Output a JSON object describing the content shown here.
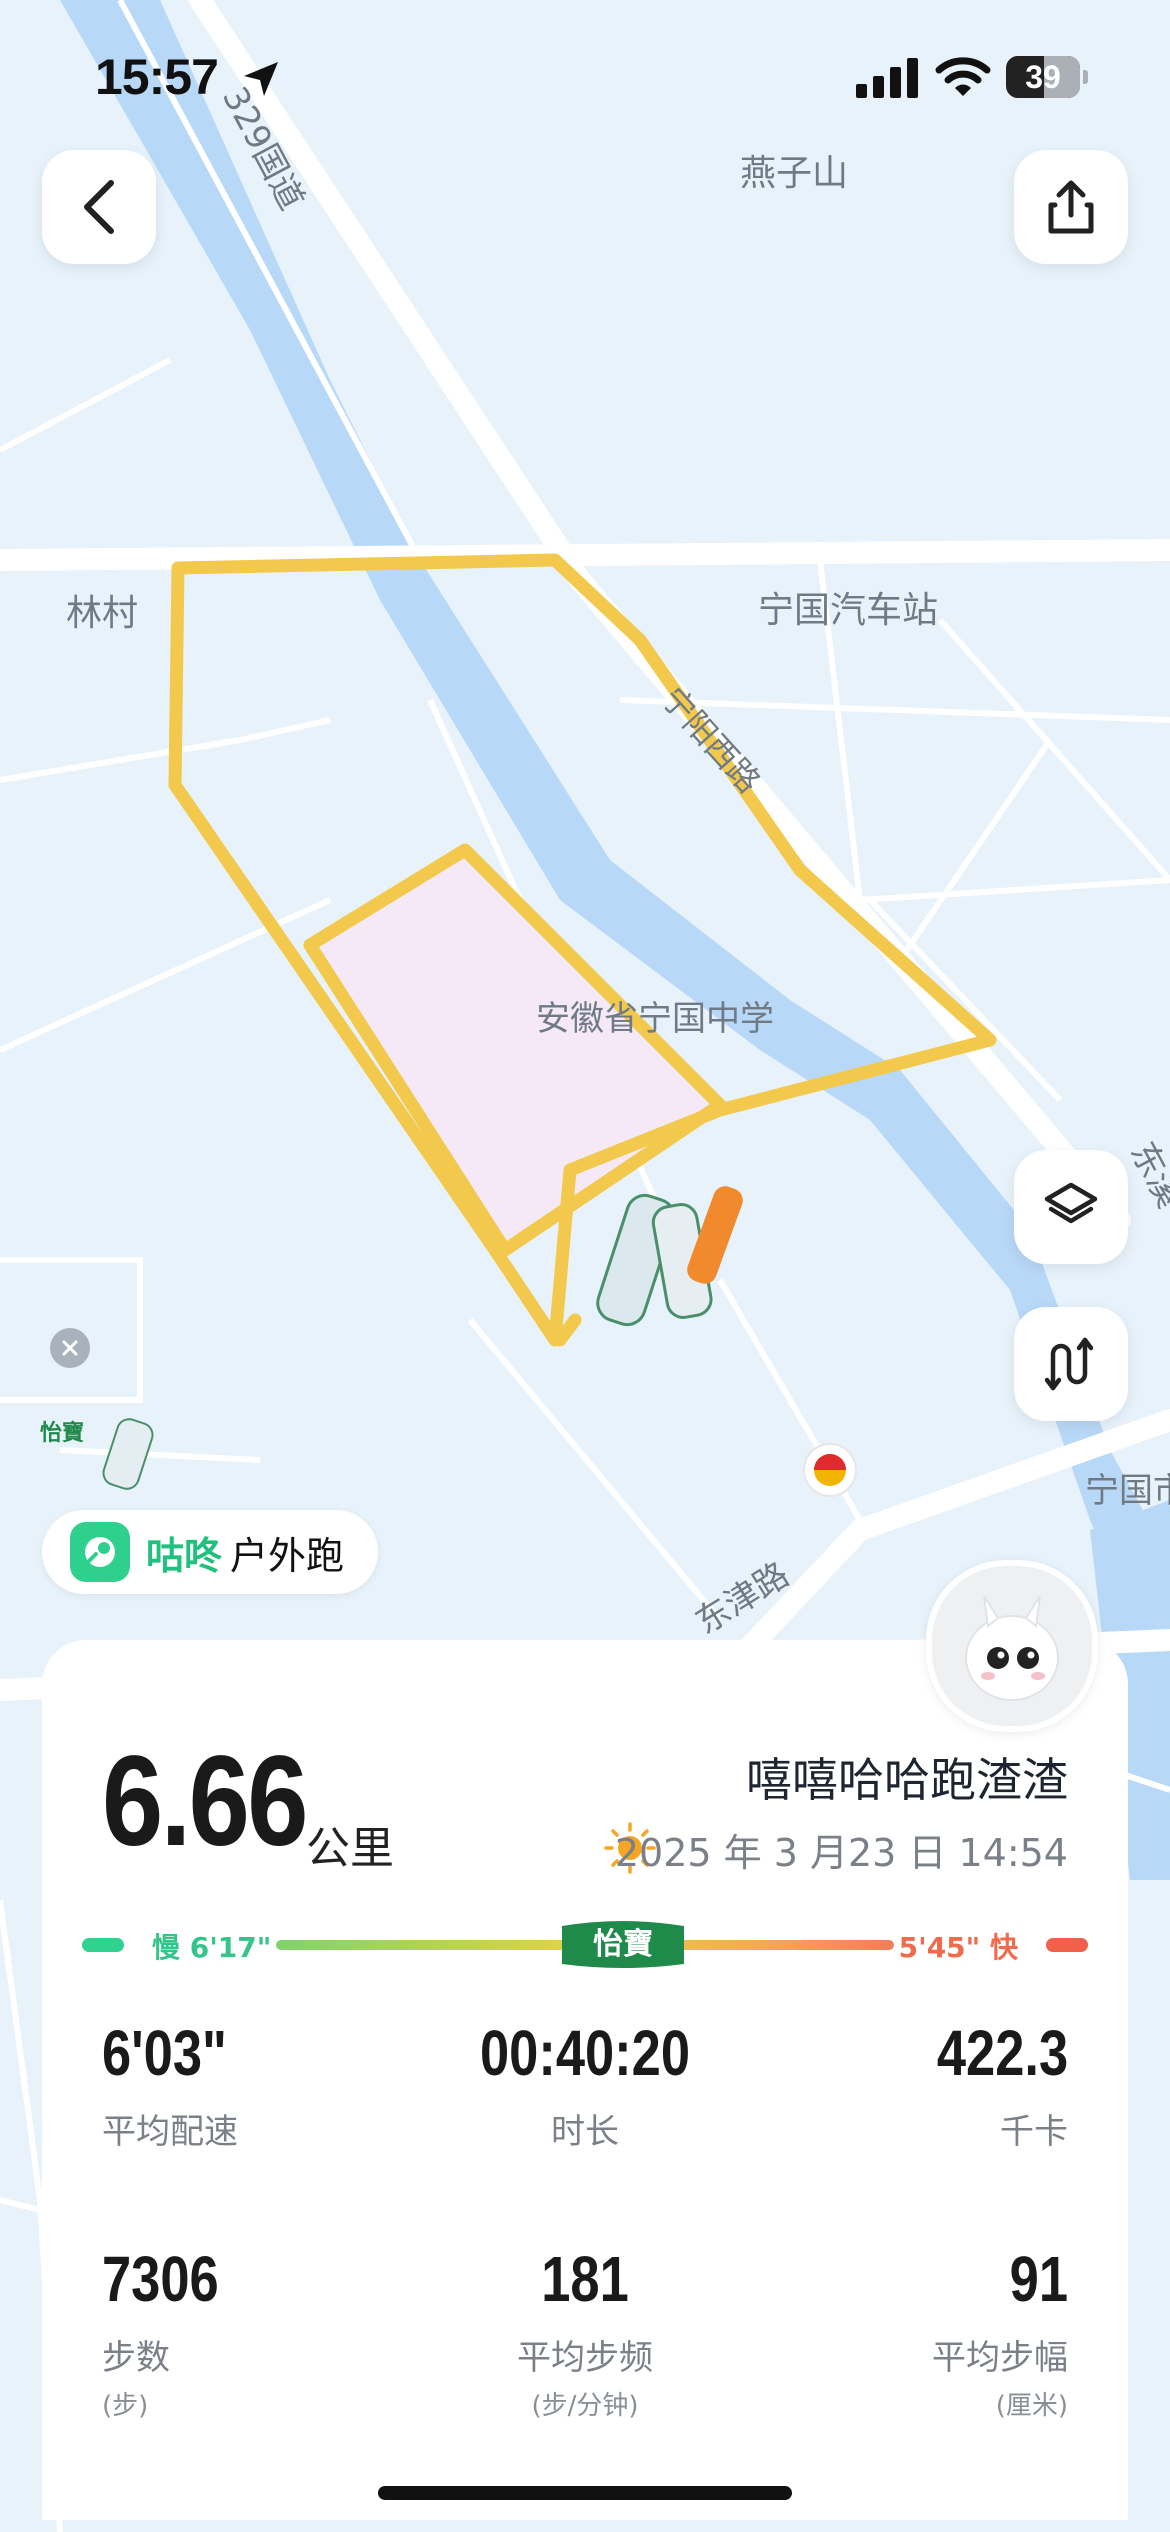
{
  "status_bar": {
    "time": "15:57",
    "battery": "39"
  },
  "map": {
    "labels": {
      "yanzishan": "燕子山",
      "road_329": "329国道",
      "lincun": "林村",
      "bus_station": "宁国汽车站",
      "school": "安徽省宁国中学",
      "dongjin_road": "东津路",
      "ningguo_city": "宁国市",
      "dongxi": "东溪",
      "river_road": "宁阳西路"
    },
    "route_color": "#f2c94c"
  },
  "brand": {
    "name": "咕咚",
    "mode": "户外跑",
    "color": "#2fd08d"
  },
  "summary": {
    "distance": "6.66",
    "distance_unit": "公里",
    "username": "嘻嘻哈哈跑渣渣",
    "datetime": "2025 年 3 月23 日 14:54"
  },
  "pace_bar": {
    "slow_label": "慢 6'17\"",
    "fast_label": "5'45\" 快",
    "badge": "怡寶"
  },
  "stats": [
    {
      "value": "6'03\"",
      "label": "平均配速",
      "unit": ""
    },
    {
      "value": "00:40:20",
      "label": "时长",
      "unit": ""
    },
    {
      "value": "422.3",
      "label": "千卡",
      "unit": ""
    },
    {
      "value": "7306",
      "label": "步数",
      "unit": "(步)"
    },
    {
      "value": "181",
      "label": "平均步频",
      "unit": "(步/分钟)"
    },
    {
      "value": "91",
      "label": "平均步幅",
      "unit": "(厘米)"
    }
  ],
  "icons": {
    "back": "chevron-left-icon",
    "share": "share-icon",
    "layers": "layers-icon",
    "route": "route-icon",
    "sun": "sun-icon"
  }
}
